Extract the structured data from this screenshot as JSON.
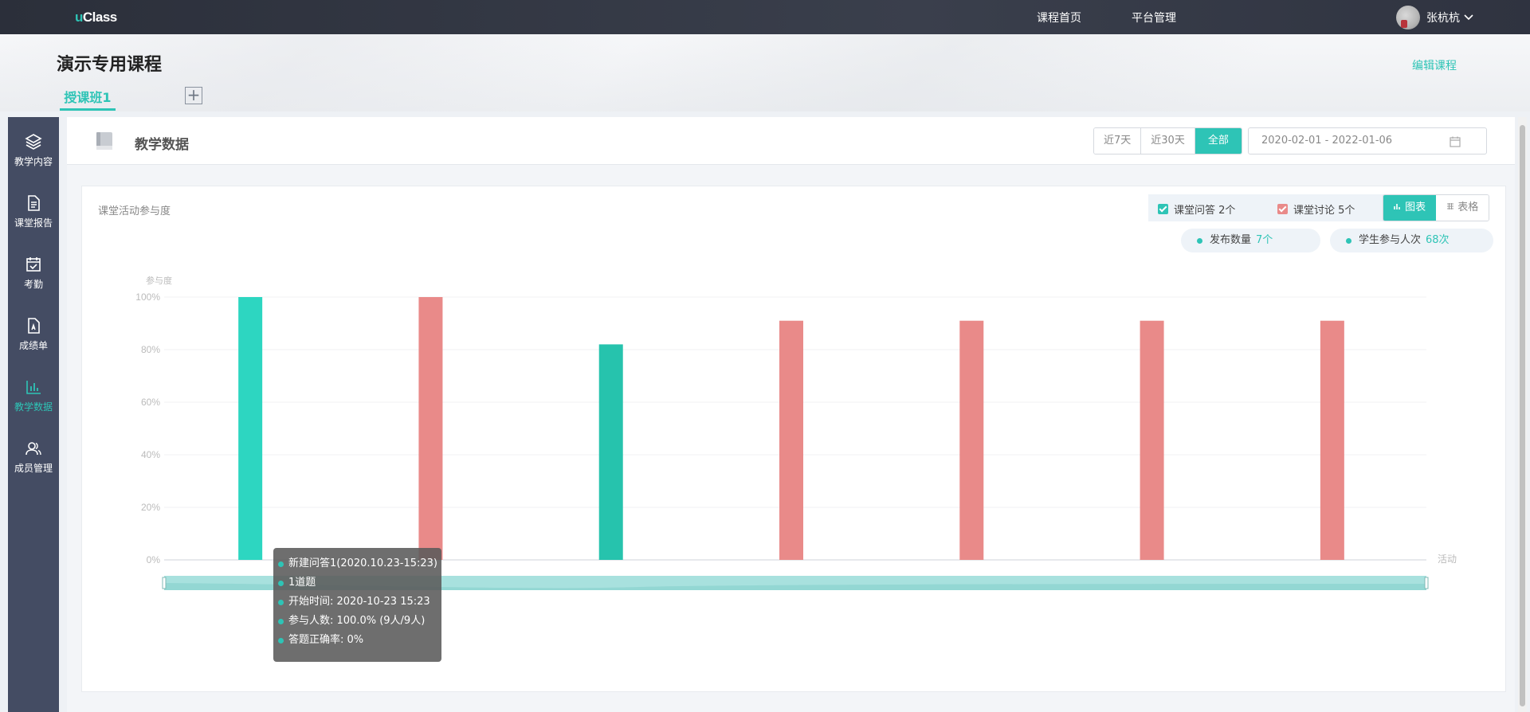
{
  "topbar": {
    "logo_u": "u",
    "logo_rest": "Class",
    "nav": [
      "课程首页",
      "平台管理"
    ],
    "user_name": "张杭杭"
  },
  "course": {
    "title": "演示专用课程",
    "edit_label": "编辑课程",
    "class_tab": "授课班1",
    "add_tab": "+"
  },
  "sidebar": {
    "items": [
      {
        "label": "教学内容",
        "icon": "layers-icon"
      },
      {
        "label": "课堂报告",
        "icon": "document-icon"
      },
      {
        "label": "考勤",
        "icon": "calendar-check-icon"
      },
      {
        "label": "成绩单",
        "icon": "grade-file-icon"
      },
      {
        "label": "教学数据",
        "icon": "bar-chart-icon",
        "active": true
      },
      {
        "label": "成员管理",
        "icon": "members-icon"
      }
    ]
  },
  "section": {
    "title": "教学数据",
    "ranges": [
      "近7天",
      "近30天",
      "全部"
    ],
    "active_range": "全部",
    "date_range": "2020-02-01 - 2022-01-06"
  },
  "card": {
    "title": "课堂活动参与度",
    "legend": [
      {
        "label": "课堂问答 2个",
        "color": "#2ec4b6"
      },
      {
        "label": "课堂讨论 5个",
        "color": "#e98a89"
      }
    ],
    "views": [
      "图表",
      "表格"
    ],
    "active_view": "图表",
    "stats": [
      {
        "label": "发布数量",
        "value": "7个"
      },
      {
        "label": "学生参与人次",
        "value": "68次"
      }
    ]
  },
  "chart_data": {
    "type": "bar",
    "ylabel": "参与度",
    "xlabel": "活动",
    "yticks": [
      "100%",
      "80%",
      "60%",
      "40%",
      "20%",
      "0%"
    ],
    "ylim": [
      0,
      100
    ],
    "values": [
      100,
      100,
      82,
      91,
      91,
      91,
      91
    ],
    "colors": [
      "#2dd6c1",
      "#e98a89",
      "#26c3ad",
      "#e98a89",
      "#e98a89",
      "#e98a89",
      "#e98a89"
    ],
    "grid": true
  },
  "tooltip": {
    "lines": [
      "新建问答1(2020.10.23-15:23)",
      "1道题",
      "开始时间: 2020-10-23 15:23",
      "参与人数: 100.0% (9人/9人)",
      "答题正确率: 0%"
    ]
  }
}
